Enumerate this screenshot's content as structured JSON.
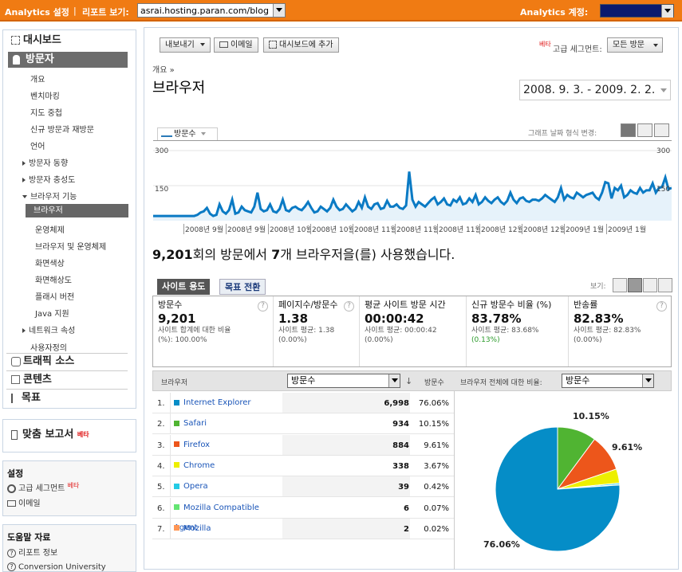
{
  "topbar": {
    "settings_label": "Analytics 설정",
    "report_view_label": "리포트 보기:",
    "site_value": "asrai.hosting.paran.com/blog",
    "account_label": "Analytics 계정:"
  },
  "sidebar": {
    "dashboard": "대시보드",
    "visitors": "방문자",
    "visitor_items": [
      "개요",
      "벤치마킹",
      "지도 중첩",
      "신규 방문과 재방문",
      "언어",
      "방문자 동향",
      "방문자 충성도",
      "브라우저 기능"
    ],
    "browser_items": [
      "브라우저",
      "운영체제",
      "브라우저 및 운영체제",
      "화면색상",
      "화면해상도",
      "플래시 버전",
      "Java 지원"
    ],
    "after_items": [
      "네트워크 속성",
      "사용자정의"
    ],
    "traffic": "트래픽 소스",
    "content": "콘텐츠",
    "goals": "목표",
    "custom_reports": "맞춤 보고서",
    "beta": "베타",
    "settings_title": "설정",
    "settings_items": [
      "고급 세그먼트",
      "이메일"
    ],
    "help_title": "도움말 자료",
    "help_items": [
      "리포트 정보",
      "Conversion University"
    ]
  },
  "toolbar": {
    "export": "내보내기",
    "email": "이메일",
    "add_dashboard": "대시보드에 추가",
    "beta": "베타",
    "segment_label": "고급 세그먼트:",
    "segment_value": "모든 방문"
  },
  "page": {
    "breadcrumb": "개요 »",
    "title": "브라우저",
    "date_range": "2008. 9. 3. - 2009. 2. 2."
  },
  "graph": {
    "metric_tab": "방문수",
    "view_label": "그래프 날짜 형식 변경:",
    "y_max": "300",
    "y_mid": "150",
    "y_max_right": "300",
    "y_mid_right": "150",
    "x_labels": [
      "2008년 9월",
      "2008년 9월",
      "2008년 10월",
      "2008년 10월",
      "2008년 11월",
      "2008년 11월",
      "2008년 11월",
      "2008년 12월",
      "2008년 12월",
      "2009년 1월",
      "2009년 1월"
    ]
  },
  "summary": {
    "visits": "9,201",
    "text_a": "회의 방문에서 ",
    "count": "7",
    "text_b": "개 브라우저을(를) 사용했습니다."
  },
  "tabs": {
    "site_usage": "사이트 용도",
    "goal_conversion": "목표 전환",
    "view_label": "보기:"
  },
  "metrics": [
    {
      "title": "방문수",
      "value": "9,201",
      "sub1": "사이트 합계에 대한 비율",
      "sub2": "(%): 100.00%"
    },
    {
      "title": "페이지수/방문수",
      "value": "1.38",
      "sub1": "사이트 평균: 1.38",
      "sub2": "(0.00%)"
    },
    {
      "title": "평균 사이트 방문 시간",
      "value": "00:00:42",
      "sub1": "사이트 평균: 00:00:42",
      "sub2": "(0.00%)"
    },
    {
      "title": "신규 방문수 비율 (%)",
      "value": "83.78%",
      "sub1": "사이트 평균: 83.68%",
      "sub2": "(0.13%)"
    },
    {
      "title": "반송률",
      "value": "82.83%",
      "sub1": "사이트 평균: 82.83%",
      "sub2": "(0.00%)"
    }
  ],
  "table": {
    "col_browser": "브라우저",
    "sort_value": "방문수",
    "col_visits": "방문수",
    "pie_label": "브라우저 전체에 대한 비율:",
    "pie_value": "방문수",
    "rows": [
      {
        "rank": "1.",
        "name": "Internet Explorer",
        "visits": "6,998",
        "pct": "76.06%",
        "color": "#058dc7"
      },
      {
        "rank": "2.",
        "name": "Safari",
        "visits": "934",
        "pct": "10.15%",
        "color": "#50b432"
      },
      {
        "rank": "3.",
        "name": "Firefox",
        "visits": "884",
        "pct": "9.61%",
        "color": "#ed561b"
      },
      {
        "rank": "4.",
        "name": "Chrome",
        "visits": "338",
        "pct": "3.67%",
        "color": "#edef00"
      },
      {
        "rank": "5.",
        "name": "Opera",
        "visits": "39",
        "pct": "0.42%",
        "color": "#24cbe5"
      },
      {
        "rank": "6.",
        "name": "Mozilla Compatible Agent",
        "visits": "6",
        "pct": "0.07%",
        "color": "#64e572"
      },
      {
        "rank": "7.",
        "name": "Mozilla",
        "visits": "2",
        "pct": "0.02%",
        "color": "#ff9655"
      }
    ]
  },
  "pie": {
    "label_ie": "76.06%",
    "label_safari": "10.15%",
    "label_firefox": "9.61%"
  },
  "chart_data": {
    "type": "line",
    "series": [
      {
        "name": "방문수",
        "values": [
          20,
          20,
          20,
          20,
          20,
          20,
          20,
          20,
          20,
          20,
          20,
          20,
          20,
          20,
          25,
          35,
          40,
          55,
          30,
          20,
          25,
          70,
          40,
          30,
          45,
          90,
          30,
          35,
          60,
          45,
          40,
          35,
          60,
          120,
          50,
          40,
          45,
          70,
          40,
          35,
          50,
          90,
          45,
          40,
          55,
          60,
          50,
          45,
          60,
          80,
          55,
          35,
          40,
          60,
          50,
          40,
          55,
          90,
          60,
          45,
          50,
          70,
          55,
          40,
          50,
          80,
          55,
          100,
          60,
          50,
          70,
          75,
          50,
          55,
          85,
          60,
          60,
          70,
          55,
          50,
          65,
          210,
          90,
          60,
          80,
          70,
          60,
          75,
          90,
          100,
          70,
          80,
          95,
          70,
          65,
          90,
          80,
          100,
          70,
          75,
          95,
          80,
          110,
          70,
          80,
          100,
          85,
          75,
          90,
          100,
          80,
          70,
          85,
          120,
          90,
          75,
          95,
          100,
          85,
          80,
          90,
          90,
          85,
          95,
          110,
          100,
          90,
          80,
          100,
          140,
          90,
          110,
          100,
          95,
          120,
          110,
          100,
          110,
          115,
          120,
          100,
          90,
          120,
          165,
          160,
          95,
          140,
          130,
          150,
          100,
          110,
          130,
          120,
          115,
          140,
          120,
          130,
          130,
          160,
          120,
          140,
          145,
          185,
          135,
          140
        ]
      }
    ],
    "ylim": [
      0,
      300
    ]
  }
}
